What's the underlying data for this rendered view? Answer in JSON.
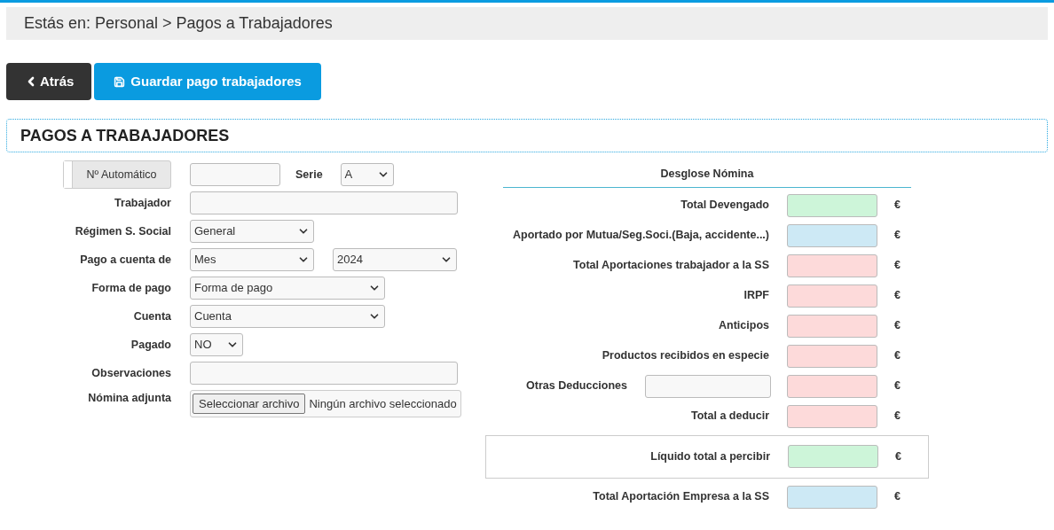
{
  "breadcrumb": "Estás en: Personal > Pagos a Trabajadores",
  "buttons": [
    {
      "kind": "back",
      "label": "Atrás"
    },
    {
      "kind": "save",
      "label": "Guardar pago trabajadores"
    }
  ],
  "section_title": "PAGOS A TRABAJADORES",
  "form": {
    "auto_number": {
      "label": "Nº Automático",
      "on": false
    },
    "serie": {
      "label": "Serie",
      "value": "A"
    },
    "fields": [
      {
        "kind": "text",
        "label": "Trabajador"
      },
      {
        "kind": "select",
        "label": "Régimen S. Social",
        "values": [
          "General"
        ]
      },
      {
        "kind": "select-pair",
        "label": "Pago a cuenta de",
        "values": [
          "Mes",
          "2024"
        ]
      },
      {
        "kind": "select-wide",
        "label": "Forma de pago",
        "values": [
          "Forma de pago"
        ]
      },
      {
        "kind": "select-wide",
        "label": "Cuenta",
        "values": [
          "Cuenta"
        ]
      },
      {
        "kind": "select-small",
        "label": "Pagado",
        "values": [
          "NO"
        ]
      },
      {
        "kind": "text",
        "label": "Observaciones"
      },
      {
        "kind": "file",
        "label": "Nómina adjunta",
        "button": "Seleccionar archivo",
        "status": "Ningún archivo seleccionado"
      }
    ]
  },
  "desglose": {
    "title": "Desglose Nómina",
    "rows": [
      {
        "kind": "plain",
        "label": "Total Devengado",
        "color": "#cdf5d9",
        "unit": "€"
      },
      {
        "kind": "plain",
        "label": "Aportado por Mutua/Seg.Soci.(Baja, accidente...)",
        "color": "#cde9f5",
        "unit": "€"
      },
      {
        "kind": "plain",
        "label": "Total Aportaciones trabajador a la SS",
        "color": "#fddada",
        "unit": "€"
      },
      {
        "kind": "plain",
        "label": "IRPF",
        "color": "#fddada",
        "unit": "€"
      },
      {
        "kind": "plain",
        "label": "Anticipos",
        "color": "#fddada",
        "unit": "€"
      },
      {
        "kind": "plain",
        "label": "Productos recibidos en especie",
        "color": "#fddada",
        "unit": "€"
      },
      {
        "kind": "with-input",
        "label": "Otras Deducciones",
        "color": "#fddada",
        "unit": "€"
      },
      {
        "kind": "plain",
        "label": "Total a deducir",
        "color": "#fddada",
        "unit": "€"
      },
      {
        "kind": "framed",
        "label": "Líquido total a percibir",
        "color": "#cdf5d9",
        "unit": "€"
      },
      {
        "kind": "plain",
        "label": "Total Aportación Empresa a la SS",
        "color": "#cde9f5",
        "unit": "€"
      }
    ]
  }
}
